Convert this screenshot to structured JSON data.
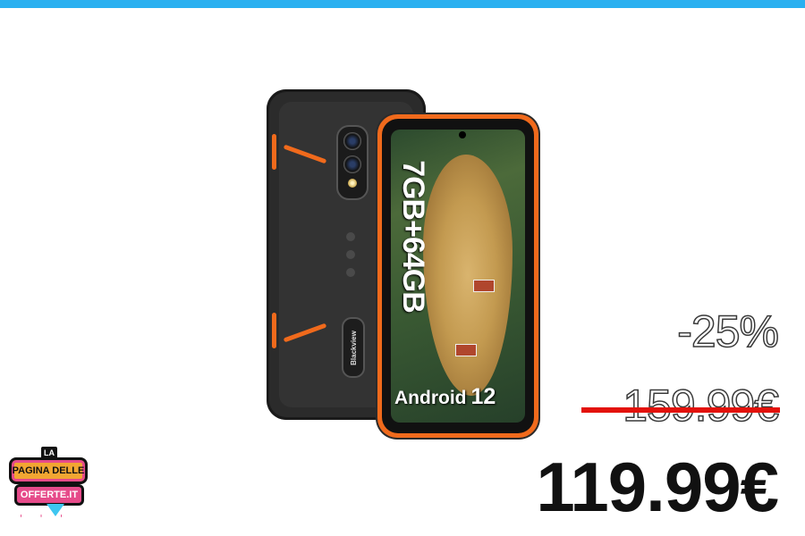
{
  "product": {
    "back_brand": "Blackview",
    "screen_spec": "7GB+64GB",
    "screen_os": "Android",
    "screen_os_version": "12"
  },
  "pricing": {
    "discount": "-25%",
    "old_price": "159.99€",
    "new_price": "119.99€"
  },
  "logo": {
    "la": "LA",
    "line1": "PAGINA DELLE",
    "line2": "OFFERTE.IT"
  },
  "colors": {
    "top_bar": "#2ab0f0",
    "accent_orange": "#f06a1c",
    "strike_red": "#e3120b"
  }
}
